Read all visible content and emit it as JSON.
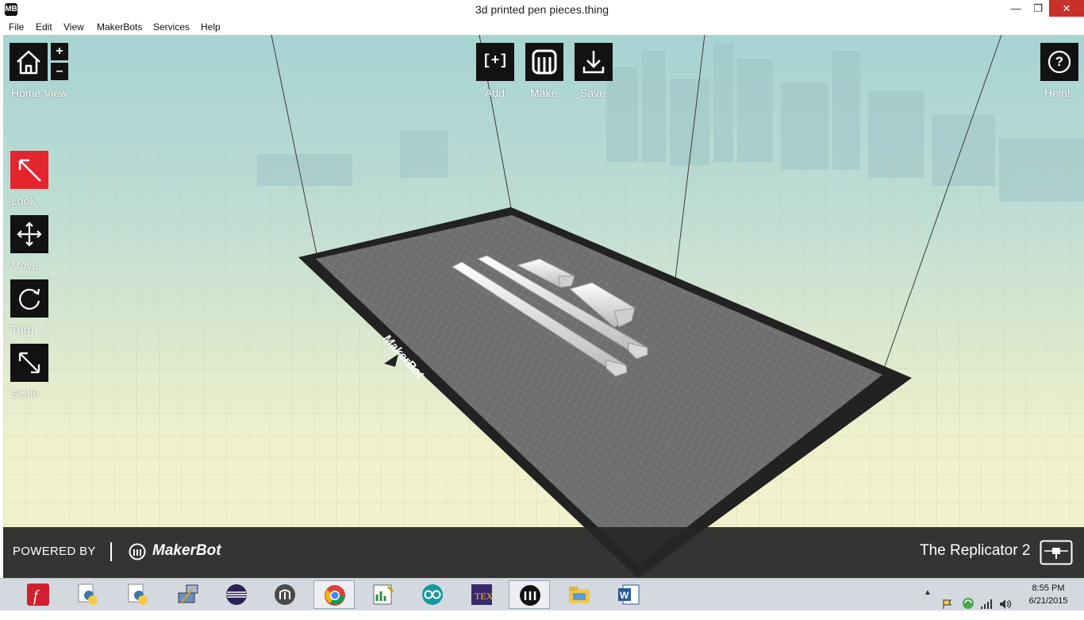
{
  "window": {
    "title": "3d printed pen pieces.thing",
    "app_icon": "MB",
    "min_glyph": "—",
    "max_glyph": "❐",
    "close_glyph": "✕"
  },
  "menu": [
    "File",
    "Edit",
    "View",
    "MakerBots",
    "Services",
    "Help"
  ],
  "toolbar": {
    "home_view": "Home View",
    "zoom_in": "+",
    "zoom_out": "–",
    "look": "Look",
    "move": "Move",
    "turn": "Turn",
    "scale": "Scale",
    "add": "Add",
    "add_glyph": "[+]",
    "make": "Make",
    "save": "Save",
    "help": "Help!",
    "help_glyph": "?"
  },
  "build_plate": {
    "logo_text": "MakerBot"
  },
  "bottom_bar": {
    "powered_by": "POWERED BY",
    "brand": "MakerBot",
    "printer": "The Replicator 2"
  },
  "taskbar": {
    "apps": [
      "flash-player-icon",
      "python-icon",
      "python-icon",
      "network-tool-icon",
      "eclipse-icon",
      "makerware-elephant-icon",
      "chrome-icon",
      "chart-editor-icon",
      "arduino-icon",
      "texworks-icon",
      "makerware-icon",
      "file-explorer-icon",
      "word-icon"
    ],
    "time": "8:55 PM",
    "date": "6/21/2015",
    "tray_arrow": "▲"
  },
  "colors": {
    "button_bg": "#121212",
    "look_active": "#e3262e",
    "close_red": "#c7312a"
  }
}
